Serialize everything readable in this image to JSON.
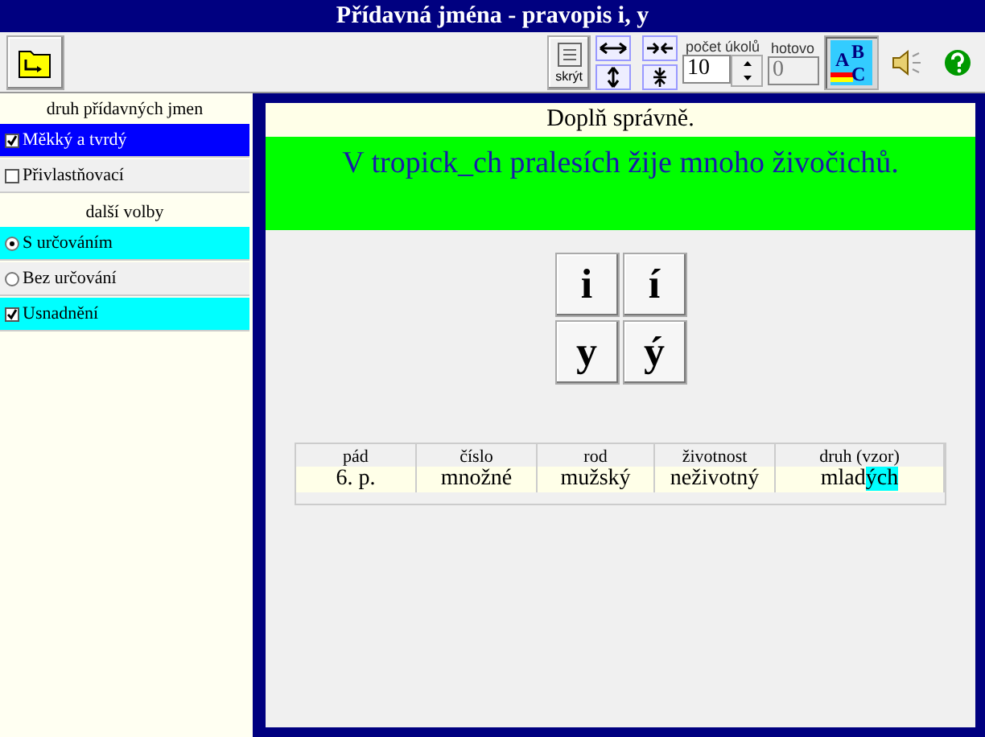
{
  "window": {
    "title": "Přídavná jména - pravopis i, y"
  },
  "toolbar": {
    "hide_label": "skrýt",
    "count_label": "počet úkolů",
    "count_value": "10",
    "done_label": "hotovo",
    "done_placeholder": "0",
    "abc_pressed": true,
    "abc_letters": [
      "A",
      "B",
      "C"
    ]
  },
  "sidebar": {
    "groups": [
      {
        "title": "druh přídavných jmen",
        "items": [
          {
            "kind": "checkbox",
            "label": "Měkký a tvrdý",
            "checked": true,
            "selected": true
          },
          {
            "kind": "checkbox",
            "label": "Přivlastňovací",
            "checked": false,
            "selected": false
          }
        ]
      },
      {
        "title": "další volby",
        "items": [
          {
            "kind": "radio",
            "label": "S určováním",
            "checked": true,
            "selected": true
          },
          {
            "kind": "radio",
            "label": "Bez určování",
            "checked": false,
            "selected": false
          },
          {
            "kind": "checkbox",
            "label": "Usnadnění",
            "checked": true,
            "selected": true
          }
        ]
      }
    ]
  },
  "exercise": {
    "instruction": "Doplň správně.",
    "sentence": "V tropick_ch pralesích žije mnoho živočichů.",
    "answers": [
      "i",
      "í",
      "y",
      "ý"
    ],
    "table": {
      "columns": [
        "pád",
        "číslo",
        "rod",
        "životnost",
        "druh (vzor)"
      ],
      "cells": [
        {
          "text": "6. p."
        },
        {
          "text": "množné"
        },
        {
          "text": "mužský"
        },
        {
          "text": "neživotný"
        },
        {
          "text": "mlad",
          "highlight": "ých"
        }
      ]
    }
  }
}
